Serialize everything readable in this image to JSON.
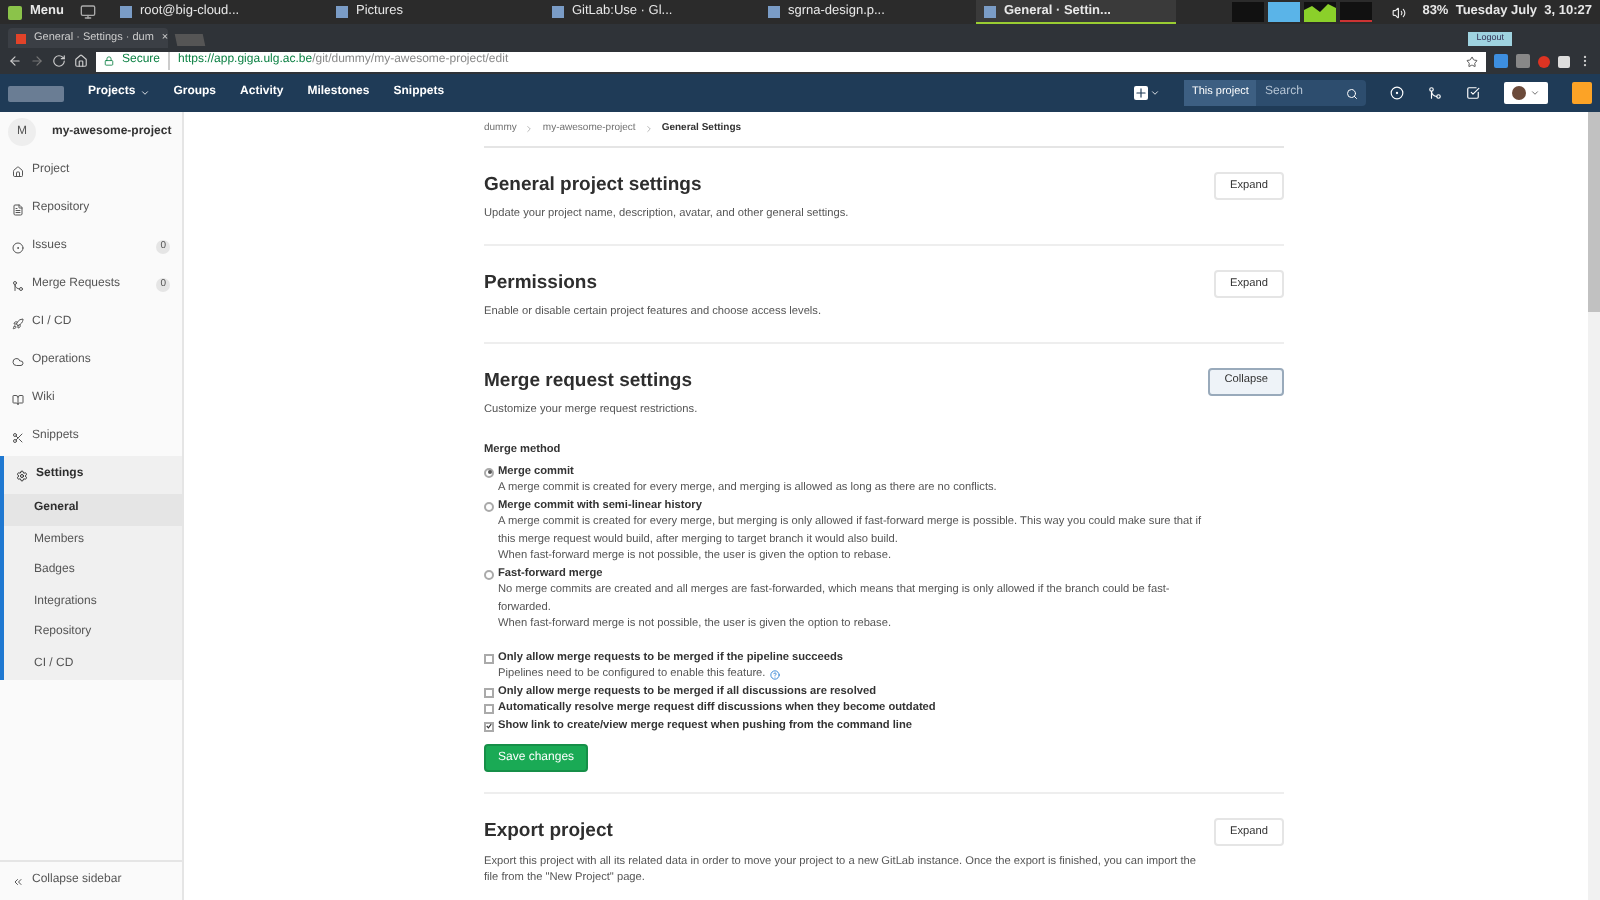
{
  "os_taskbar": {
    "menu": "Menu",
    "windows": [
      {
        "title": "root@big-cloud...",
        "selected": false
      },
      {
        "title": "Pictures",
        "selected": false
      },
      {
        "title": "GitLab:Use · Gl...",
        "selected": false
      },
      {
        "title": "sgrna-design.p...",
        "selected": false
      },
      {
        "title": "General · Settin...",
        "selected": true
      }
    ],
    "status": "83%  Tuesday July  3, 10:27",
    "logout": "Logout"
  },
  "browser": {
    "tab": {
      "title": "General · Settings · dum",
      "close": "×"
    },
    "address": {
      "secure": "Secure",
      "url_host": "https://app.giga.ulg.ac.be",
      "url_path": "/git/dummy/my-awesome-project/edit"
    }
  },
  "nav": {
    "items": [
      {
        "label": "Projects",
        "dropdown": true
      },
      {
        "label": "Groups",
        "dropdown": false
      },
      {
        "label": "Activity",
        "dropdown": false
      },
      {
        "label": "Milestones",
        "dropdown": false
      },
      {
        "label": "Snippets",
        "dropdown": false
      }
    ],
    "scope": "This project",
    "search_placeholder": "Search"
  },
  "sidebar": {
    "project": {
      "initial": "M",
      "name": "my-awesome-project"
    },
    "items": [
      {
        "label": "Project",
        "selected": false
      },
      {
        "label": "Repository",
        "selected": false
      },
      {
        "label": "Issues",
        "count": "0",
        "selected": false
      },
      {
        "label": "Merge Requests",
        "count": "0",
        "selected": false
      },
      {
        "label": "CI / CD",
        "selected": false
      },
      {
        "label": "Operations",
        "selected": false
      },
      {
        "label": "Wiki",
        "selected": false
      },
      {
        "label": "Snippets",
        "selected": false
      },
      {
        "label": "Settings",
        "selected": true,
        "children": [
          {
            "label": "General",
            "selected": true
          },
          {
            "label": "Members",
            "selected": false
          },
          {
            "label": "Badges",
            "selected": false
          },
          {
            "label": "Integrations",
            "selected": false
          },
          {
            "label": "Repository",
            "selected": false
          },
          {
            "label": "CI / CD",
            "selected": false
          }
        ]
      }
    ],
    "collapse": "Collapse sidebar"
  },
  "breadcrumb": [
    "dummy",
    "my-awesome-project",
    "General Settings"
  ],
  "sections": [
    {
      "title": "General project settings",
      "description": "Update your project name, description, avatar, and other general settings.",
      "button": "Expand",
      "expanded": false
    },
    {
      "title": "Permissions",
      "description": "Enable or disable certain project features and choose access levels.",
      "button": "Expand",
      "expanded": false
    },
    {
      "title": "Merge request settings",
      "description": "Customize your merge request restrictions.",
      "button": "Collapse",
      "expanded": true,
      "body": {
        "merge_method_label": "Merge method",
        "options": [
          {
            "label": "Merge commit",
            "description": "A merge commit is created for every merge, and merging is allowed as long as there are no conflicts.",
            "selected": true
          },
          {
            "label": "Merge commit with semi-linear history",
            "description": "A merge commit is created for every merge, but merging is only allowed if fast-forward merge is possible. This way you could make sure that if this merge request would build, after merging to target branch it would also build.",
            "note": "When fast-forward merge is not possible, the user is given the option to rebase.",
            "selected": false
          },
          {
            "label": "Fast-forward merge",
            "description": "No merge commits are created and all merges are fast-forwarded, which means that merging is only allowed if the branch could be fast-forwarded.",
            "note": "When fast-forward merge is not possible, the user is given the option to rebase.",
            "selected": false
          }
        ],
        "checkboxes": [
          {
            "label": "Only allow merge requests to be merged if the pipeline succeeds",
            "help": "Pipelines need to be configured to enable this feature.",
            "checked": false
          },
          {
            "label": "Only allow merge requests to be merged if all discussions are resolved",
            "checked": false
          },
          {
            "label": "Automatically resolve merge request diff discussions when they become outdated",
            "checked": false
          },
          {
            "label": "Show link to create/view merge request when pushing from the command line",
            "checked": true
          }
        ],
        "save": "Save changes"
      }
    },
    {
      "title": "Export project",
      "description": "Export this project with all its related data in order to move your project to a new GitLab instance. Once the export is finished, you can import the file from the \"New Project\" page.",
      "button": "Expand",
      "expanded": false
    }
  ]
}
